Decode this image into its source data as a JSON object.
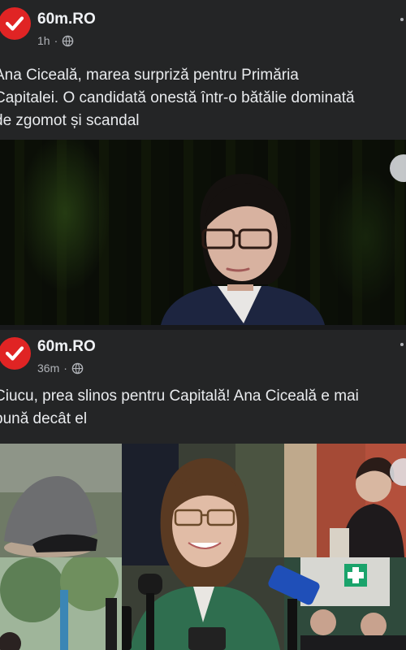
{
  "posts": [
    {
      "page_name": "60m.RO",
      "time": "1h",
      "text_lines": [
        "Ana Ciceală, marea surpriză pentru Primăria",
        "Capitalei. O candidată onestă într-o bătălie dominată",
        "de zgomot și scandal"
      ]
    },
    {
      "page_name": "60m.RO",
      "time": "36m",
      "text_lines": [
        "Ciucu, prea slinos pentru Capitală! Ana Ciceală e mai",
        "bună decât el"
      ]
    }
  ],
  "colors": {
    "background": "#18191b",
    "card": "#242526",
    "brand_red": "#e02424",
    "text_primary": "#e4e6eb",
    "text_secondary": "#b0b3b8"
  },
  "icons": {
    "avatar": "check-icon",
    "privacy": "globe-icon",
    "menu": "more-options-icon"
  }
}
